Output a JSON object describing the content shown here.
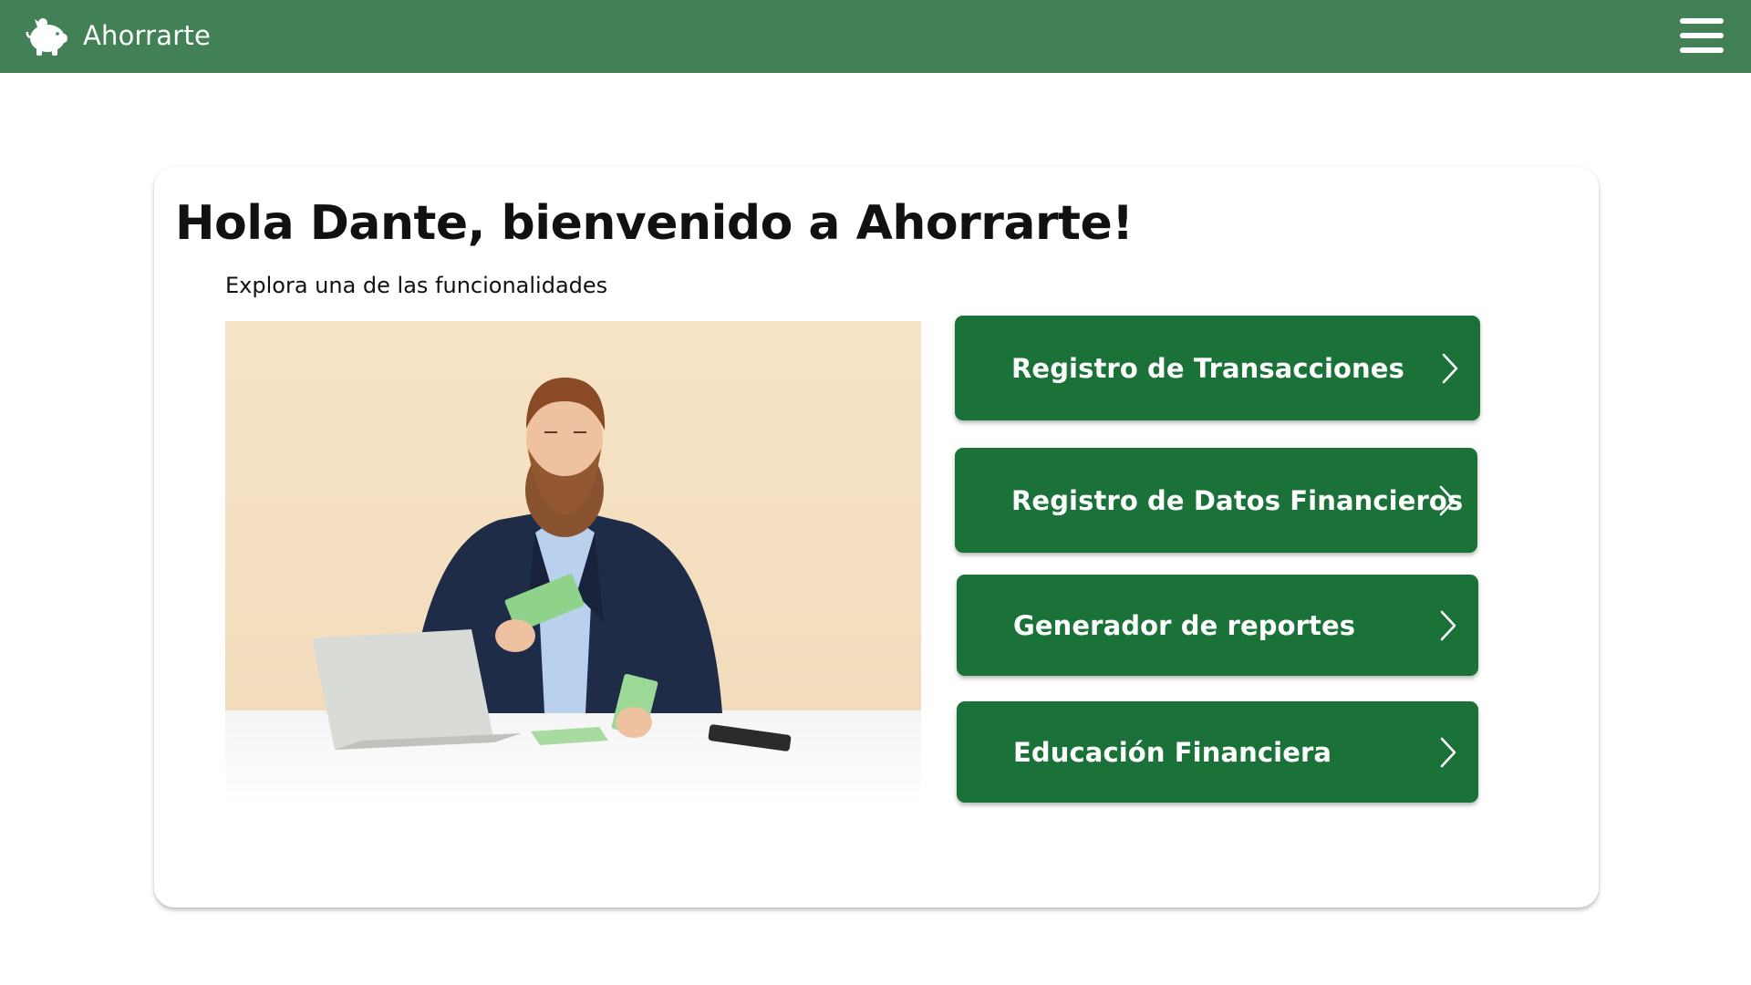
{
  "navbar": {
    "brand_name": "Ahorrarte",
    "logo_icon": "piggy-bank-icon",
    "menu_icon": "hamburger-menu-icon",
    "background_color": "#428156"
  },
  "main": {
    "title": "Hola Dante, bienvenido a Ahorrarte!",
    "subtitle": "Explora una de las funcionalidades",
    "actions": [
      {
        "label": "Registro de Transacciones",
        "icon": "chevron-right-icon"
      },
      {
        "label": "Registro de Datos Financieros",
        "icon": "chevron-right-icon"
      },
      {
        "label": "Generador de reportes",
        "icon": "chevron-right-icon"
      },
      {
        "label": "Educación Financiera",
        "icon": "chevron-right-icon"
      }
    ],
    "button_color": "#1b7238"
  }
}
